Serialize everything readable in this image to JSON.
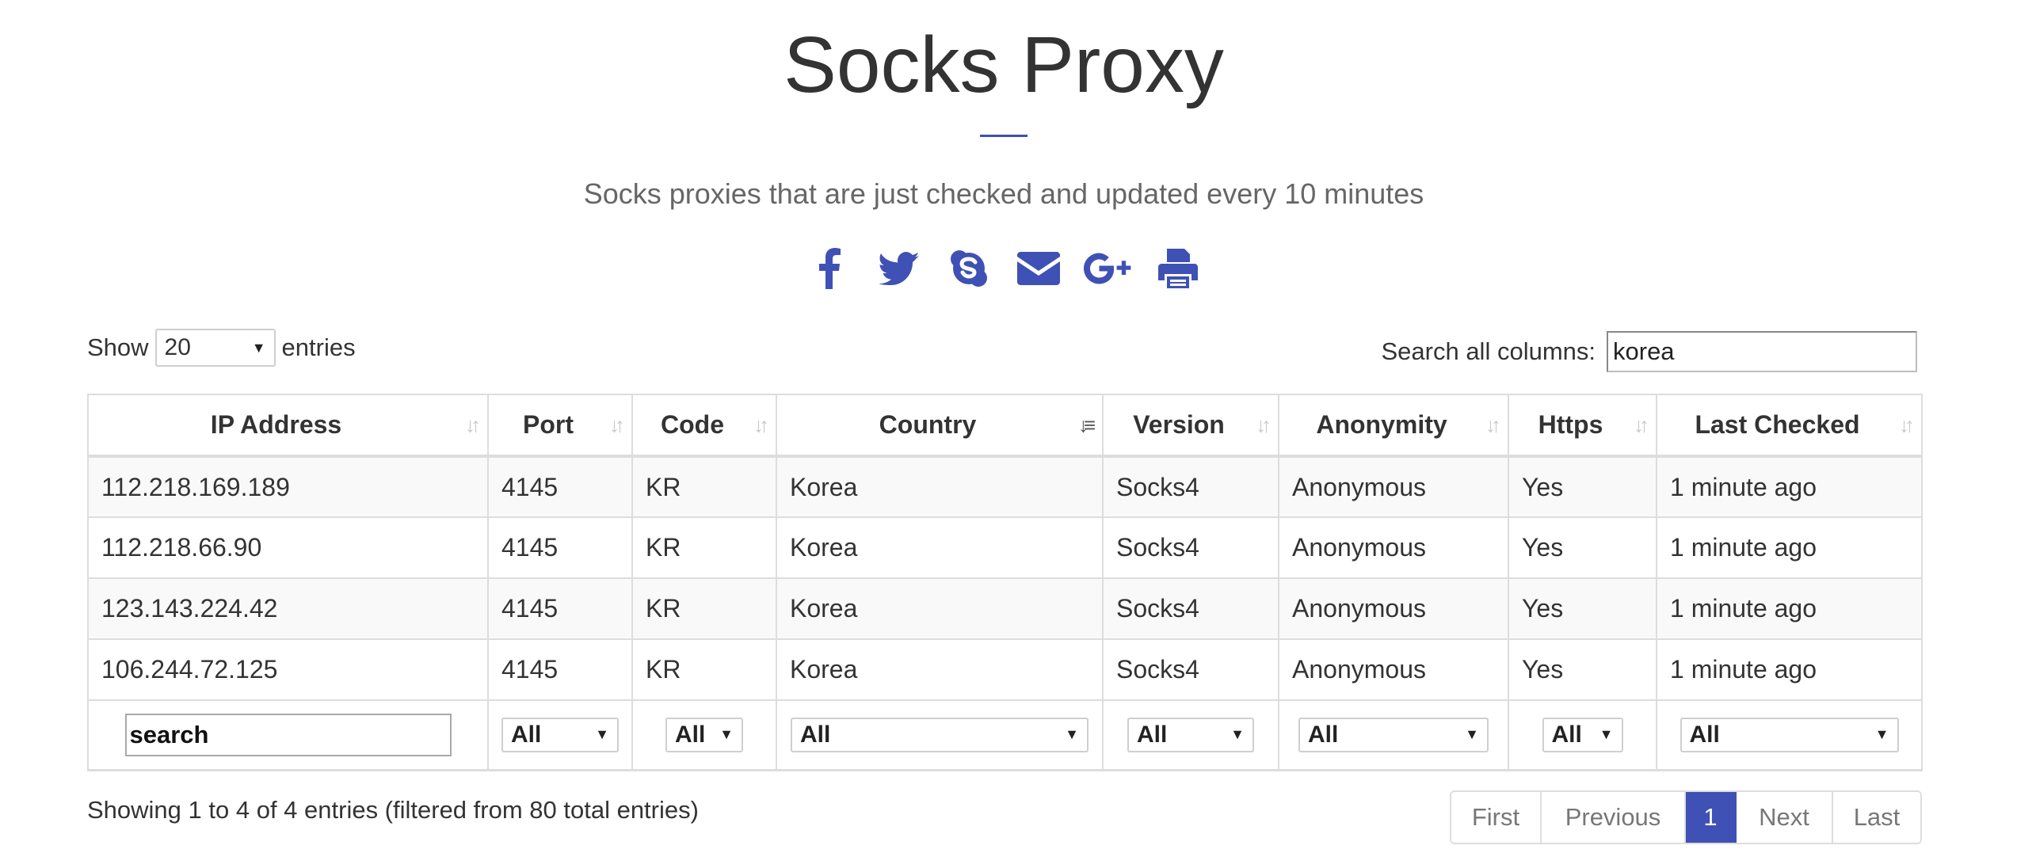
{
  "header": {
    "title": "Socks Proxy",
    "subtitle": "Socks proxies that are just checked and updated every 10 minutes"
  },
  "share": {
    "accent_color": "#3f51b5",
    "icons": [
      "facebook-icon",
      "twitter-icon",
      "skype-icon",
      "email-icon",
      "google-plus-icon",
      "print-icon"
    ]
  },
  "length_control": {
    "show_label": "Show",
    "value": "20",
    "entries_label": "entries"
  },
  "search": {
    "label": "Search all columns:",
    "value": "korea"
  },
  "table": {
    "columns": [
      "IP Address",
      "Port",
      "Code",
      "Country",
      "Version",
      "Anonymity",
      "Https",
      "Last Checked"
    ],
    "sorted_column": "Country",
    "rows": [
      [
        "112.218.169.189",
        "4145",
        "KR",
        "Korea",
        "Socks4",
        "Anonymous",
        "Yes",
        "1 minute ago"
      ],
      [
        "112.218.66.90",
        "4145",
        "KR",
        "Korea",
        "Socks4",
        "Anonymous",
        "Yes",
        "1 minute ago"
      ],
      [
        "123.143.224.42",
        "4145",
        "KR",
        "Korea",
        "Socks4",
        "Anonymous",
        "Yes",
        "1 minute ago"
      ],
      [
        "106.244.72.125",
        "4145",
        "KR",
        "Korea",
        "Socks4",
        "Anonymous",
        "Yes",
        "1 minute ago"
      ]
    ],
    "filters": {
      "ip_placeholder": "search",
      "port": "All",
      "code": "All",
      "country": "All",
      "version": "All",
      "anonymity": "All",
      "https": "All",
      "last_checked": "All"
    }
  },
  "footer": {
    "info": "Showing 1 to 4 of 4 entries (filtered from 80 total entries)",
    "pagination": {
      "first": "First",
      "previous": "Previous",
      "current": "1",
      "next": "Next",
      "last": "Last"
    }
  }
}
